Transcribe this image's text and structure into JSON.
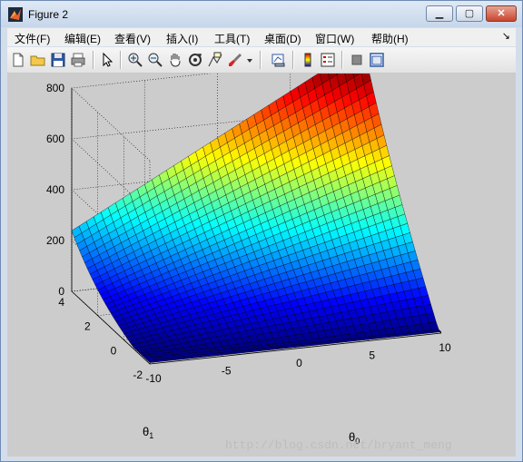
{
  "window": {
    "title": "Figure 2",
    "min_glyph": "▁",
    "max_glyph": "▢",
    "close_glyph": "✕"
  },
  "menu": {
    "items": [
      "文件(F)",
      "编辑(E)",
      "查看(V)",
      "插入(I)",
      "工具(T)",
      "桌面(D)",
      "窗口(W)",
      "帮助(H)"
    ],
    "dock_glyph": "↘"
  },
  "toolbar": {
    "icons": [
      "new-figure-icon",
      "open-file-icon",
      "save-icon",
      "print-icon",
      "select-arrow-icon",
      "zoom-in-icon",
      "zoom-out-icon",
      "pan-icon",
      "rotate-3d-icon",
      "data-cursor-icon",
      "brush-icon",
      "brush-dropdown-icon",
      "link-plot-icon",
      "colorbar-icon",
      "legend-icon",
      "hide-plot-tools-icon",
      "show-plot-tools-icon"
    ]
  },
  "chart_data": {
    "type": "surface",
    "xlabel": "θ0",
    "ylabel": "θ1",
    "zlabel": "",
    "xlim": [
      -10,
      10
    ],
    "ylim": [
      -2,
      4
    ],
    "zlim": [
      0,
      800
    ],
    "xticks": [
      "-10",
      "-5",
      "0",
      "5",
      "10"
    ],
    "yticks": [
      "-2",
      "0",
      "2",
      "4"
    ],
    "zticks": [
      "0",
      "200",
      "400",
      "600",
      "800"
    ],
    "colormap": "jet",
    "grid": true,
    "corners": [
      {
        "theta0": -10,
        "theta1": -2,
        "J": 0
      },
      {
        "theta0": 10,
        "theta1": -2,
        "J": 0
      },
      {
        "theta0": -10,
        "theta1": 4,
        "J": 200
      },
      {
        "theta0": 10,
        "theta1": 4,
        "J": 810
      }
    ],
    "minimum": {
      "theta0": -4,
      "theta1": 1.2,
      "J": 5
    }
  },
  "watermark": "http://blog.csdn.net/bryant_meng"
}
